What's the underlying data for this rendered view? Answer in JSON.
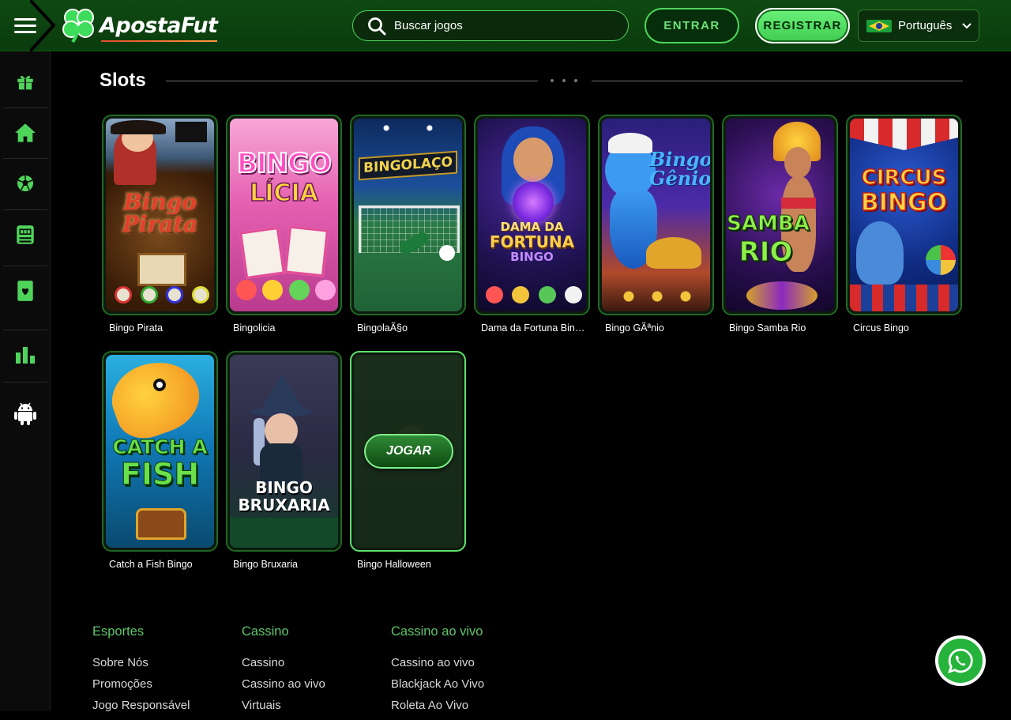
{
  "header": {
    "brand": "ApostaFut",
    "search_placeholder": "Buscar jogos",
    "login_label": "ENTRAR",
    "register_label": "REGISTRAR",
    "language": "Português",
    "language_flag": "brazil-flag-icon"
  },
  "sidebar": {
    "items": [
      {
        "icon": "gift-icon"
      },
      {
        "icon": "home-icon"
      },
      {
        "icon": "soccer-ball-icon"
      },
      {
        "icon": "slot-machine-icon"
      },
      {
        "icon": "playing-card-icon"
      },
      {
        "icon": "bar-chart-icon"
      },
      {
        "icon": "android-icon"
      }
    ]
  },
  "section": {
    "title": "Slots"
  },
  "games": [
    {
      "name": "Bingo Pirata",
      "art_text": "Bingo Pirata"
    },
    {
      "name": "Bingolicia",
      "art_text": "BINGO LÍCIA"
    },
    {
      "name": "BingolaÃ§o",
      "art_text": "BINGOLAÇO"
    },
    {
      "name": "Dama da Fortuna Bingo",
      "art_text": "DAMA DA FORTUNA BINGO"
    },
    {
      "name": "Bingo GÃªnio",
      "art_text": "Bingo Gênio"
    },
    {
      "name": "Bingo Samba Rio",
      "art_text": "SAMBA RIO"
    },
    {
      "name": "Circus Bingo",
      "art_text": "CIRCUS BINGO"
    },
    {
      "name": "Catch a Fish Bingo",
      "art_text": "CATCH A FISH"
    },
    {
      "name": "Bingo Bruxaria",
      "art_text": "BINGO BRUXARIA"
    },
    {
      "name": "Bingo Halloween",
      "art_text": ""
    }
  ],
  "play_button": "JOGAR",
  "footer": {
    "columns": [
      {
        "heading": "Esportes",
        "links": [
          "Sobre Nós",
          "Promoções",
          "Jogo Responsável"
        ]
      },
      {
        "heading": "Cassino",
        "links": [
          "Cassino",
          "Cassino ao vivo",
          "Virtuais"
        ]
      },
      {
        "heading": "Cassino ao vivo",
        "links": [
          "Cassino ao vivo",
          "Blackjack Ao Vivo",
          "Roleta Ao Vivo"
        ]
      }
    ]
  },
  "whatsapp": {
    "icon": "whatsapp-icon"
  },
  "colors": {
    "brand_green": "#4fd45b",
    "header_bg": "#0a3b0d",
    "footer_heading": "#5fc468"
  }
}
